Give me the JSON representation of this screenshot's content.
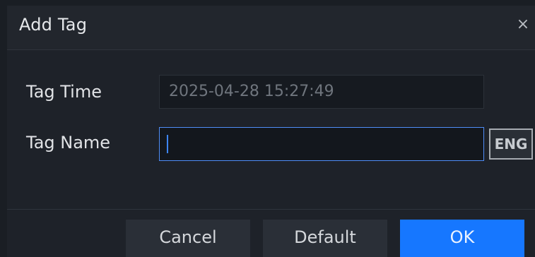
{
  "dialog": {
    "title": "Add Tag",
    "close_glyph": "×",
    "close_icon": "close-icon"
  },
  "form": {
    "tag_time_label": "Tag Time",
    "tag_time_value": "2025-04-28 15:27:49",
    "tag_name_label": "Tag Name",
    "tag_name_value": "",
    "input_language": "ENG"
  },
  "buttons": {
    "cancel": "Cancel",
    "default": "Default",
    "ok": "OK"
  },
  "colors": {
    "background": "#1e2229",
    "field_focus_border": "#4f8df7",
    "primary_button": "#1677ff"
  }
}
